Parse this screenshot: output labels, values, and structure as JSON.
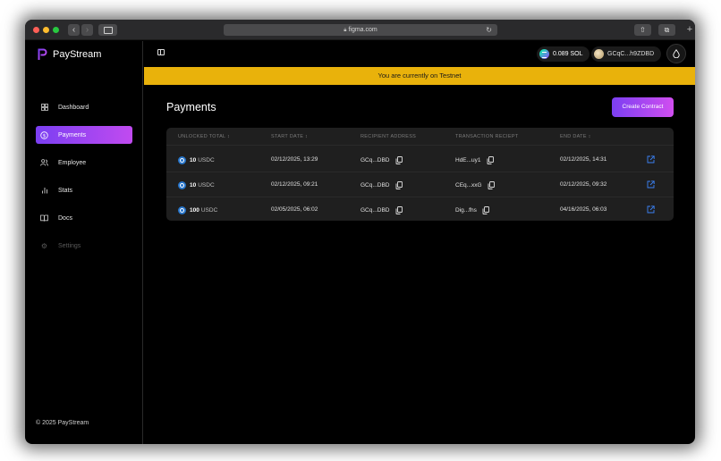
{
  "browser": {
    "url": "figma.com"
  },
  "app": {
    "name": "PayStream",
    "copyright": "© 2025 PayStream"
  },
  "sidebar": {
    "items": [
      {
        "label": "Dashboard",
        "icon": "dashboard-grid-icon",
        "active": false,
        "disabled": false
      },
      {
        "label": "Payments",
        "icon": "dollar-circle-icon",
        "active": true,
        "disabled": false
      },
      {
        "label": "Employee",
        "icon": "users-icon",
        "active": false,
        "disabled": false
      },
      {
        "label": "Stats",
        "icon": "bar-chart-icon",
        "active": false,
        "disabled": false
      },
      {
        "label": "Docs",
        "icon": "book-icon",
        "active": false,
        "disabled": false
      },
      {
        "label": "Settings",
        "icon": "gear-icon",
        "active": false,
        "disabled": true
      }
    ]
  },
  "topbar": {
    "balance": "0.089 SOL",
    "wallet": "GCqC...h9ZDBD"
  },
  "banner": {
    "text": "You are currently on Testnet",
    "color": "#e9b20b"
  },
  "main": {
    "title": "Payments",
    "create_button": "Create Contract"
  },
  "table": {
    "columns": [
      "UNLOCKED TOTAL ↕",
      "START DATE ↕",
      "RECIPIENT ADDRESS",
      "TRANSACTION RECIEPT",
      "END DATE ↕"
    ],
    "rows": [
      {
        "amount": "10",
        "unit": "USDC",
        "start": "02/12/2025, 13:29",
        "recipient": "GCq...DBD",
        "receipt": "HdE...uy1",
        "end": "02/12/2025, 14:31"
      },
      {
        "amount": "10",
        "unit": "USDC",
        "start": "02/12/2025, 09:21",
        "recipient": "GCq...DBD",
        "receipt": "CEq...xxG",
        "end": "02/12/2025, 09:32"
      },
      {
        "amount": "100",
        "unit": "USDC",
        "start": "02/05/2025, 06:02",
        "recipient": "GCq...DBD",
        "receipt": "Dig...fhs",
        "end": "04/16/2025, 06:03"
      }
    ]
  },
  "colors": {
    "accent_start": "#7b3ff2",
    "accent_end": "#d14ef0",
    "link": "#3b82f6",
    "usdc": "#2775ca"
  }
}
